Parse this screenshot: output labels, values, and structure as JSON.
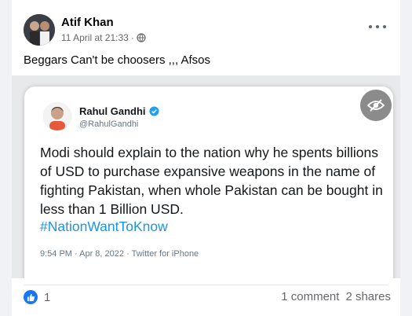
{
  "post": {
    "author": "Atif Khan",
    "date": "11 April at 21:33",
    "separator": "·",
    "privacy_icon": "globe-icon",
    "caption": "Beggars Can't be choosers ,,, Afsos"
  },
  "tweet": {
    "name": "Rahul Gandhi",
    "handle": "@RahulGandhi",
    "text": "Modi should explain to the nation why he spents billions of USD to purchase expansive weapons in the name of fighting Pakistan, when whole Pakistan can be bought in less than 1 Billion USD.",
    "hashtag": "#NationWantToKnow",
    "footer": "9:54 PM · Apr 8, 2022 · Twitter for iPhone",
    "verified_color": "#1da1f2"
  },
  "footer": {
    "like_count": "1",
    "comments": "1 comment",
    "shares": "2 shares"
  },
  "colors": {
    "background": "#f0f2f5",
    "card": "#ffffff",
    "like_blue": "#1877f2",
    "secondary_text": "#65676b"
  }
}
